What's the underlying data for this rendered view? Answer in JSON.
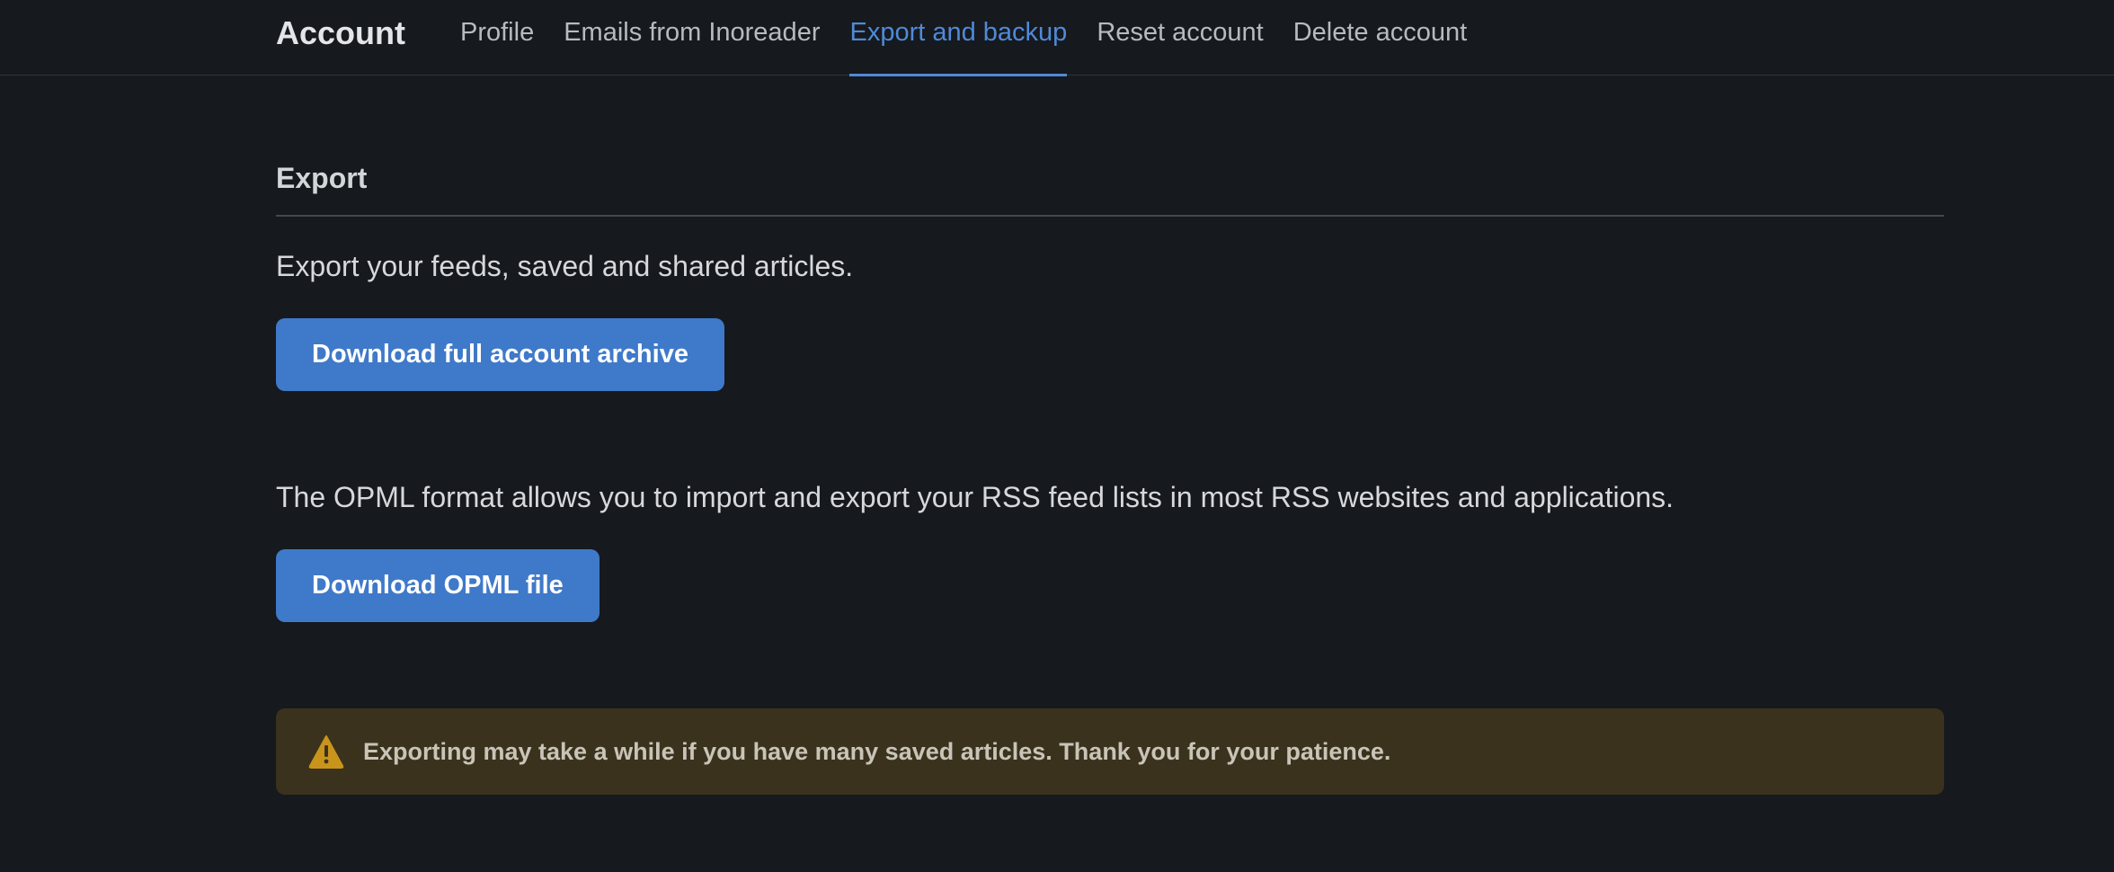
{
  "header": {
    "title": "Account",
    "tabs": [
      {
        "label": "Profile",
        "active": false
      },
      {
        "label": "Emails from Inoreader",
        "active": false
      },
      {
        "label": "Export and backup",
        "active": true
      },
      {
        "label": "Reset account",
        "active": false
      },
      {
        "label": "Delete account",
        "active": false
      }
    ]
  },
  "export": {
    "heading": "Export",
    "archive_description": "Export your feeds, saved and shared articles.",
    "archive_button": "Download full account archive",
    "opml_description": "The OPML format allows you to import and export your RSS feed lists in most RSS websites and applications.",
    "opml_button": "Download OPML file"
  },
  "notice": {
    "icon": "warning-icon",
    "text": "Exporting may take a while if you have many saved articles. Thank you for your patience."
  },
  "colors": {
    "background": "#16191d",
    "accent": "#4f8ad8",
    "button": "#3f79c9",
    "notice_bg": "#3b321d",
    "warning_icon": "#c8941b"
  }
}
